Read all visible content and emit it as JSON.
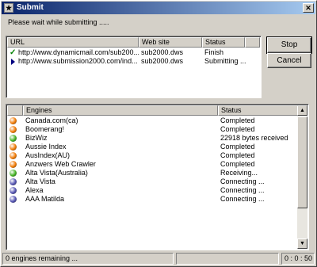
{
  "window": {
    "title": "Submit"
  },
  "message": "Please wait while submitting .....",
  "url_list": {
    "columns": [
      "URL",
      "Web site",
      "Status"
    ],
    "rows": [
      {
        "icon": "check-icon",
        "url": "http://www.dynamicmail.com/sub200...",
        "site": "sub2000.dws",
        "status": "Finish"
      },
      {
        "icon": "arrow-right-icon",
        "url": "http://www.submission2000.com/ind...",
        "site": "sub2000.dws",
        "status": "Submitting ..."
      }
    ]
  },
  "buttons": {
    "stop": "Stop",
    "cancel": "Cancel"
  },
  "engine_list": {
    "columns": [
      "Engines",
      "Status"
    ],
    "rows": [
      {
        "name": "Canada.com(ca)",
        "status": "Completed",
        "color": "#f07800"
      },
      {
        "name": "Boomerang!",
        "status": "Completed",
        "color": "#f07800"
      },
      {
        "name": "BizWiz",
        "status": "22918 bytes received",
        "color": "#40b020"
      },
      {
        "name": "Aussie Index",
        "status": "Completed",
        "color": "#f07800"
      },
      {
        "name": "AusIndex(AU)",
        "status": "Completed",
        "color": "#f07800"
      },
      {
        "name": "Anzwers Web Crawler",
        "status": "Completed",
        "color": "#f07800"
      },
      {
        "name": "Alta Vista(Australia)",
        "status": "Receiving...",
        "color": "#40b020"
      },
      {
        "name": "Alta Vista",
        "status": "Connecting ...",
        "color": "#5050b0"
      },
      {
        "name": "Alexa",
        "status": "Connecting ...",
        "color": "#5050b0"
      },
      {
        "name": "AAA Matilda",
        "status": "Connecting ...",
        "color": "#5050b0"
      }
    ]
  },
  "statusbar": {
    "remaining": "0 engines remaining ...",
    "elapsed": "0 : 0 : 50"
  }
}
